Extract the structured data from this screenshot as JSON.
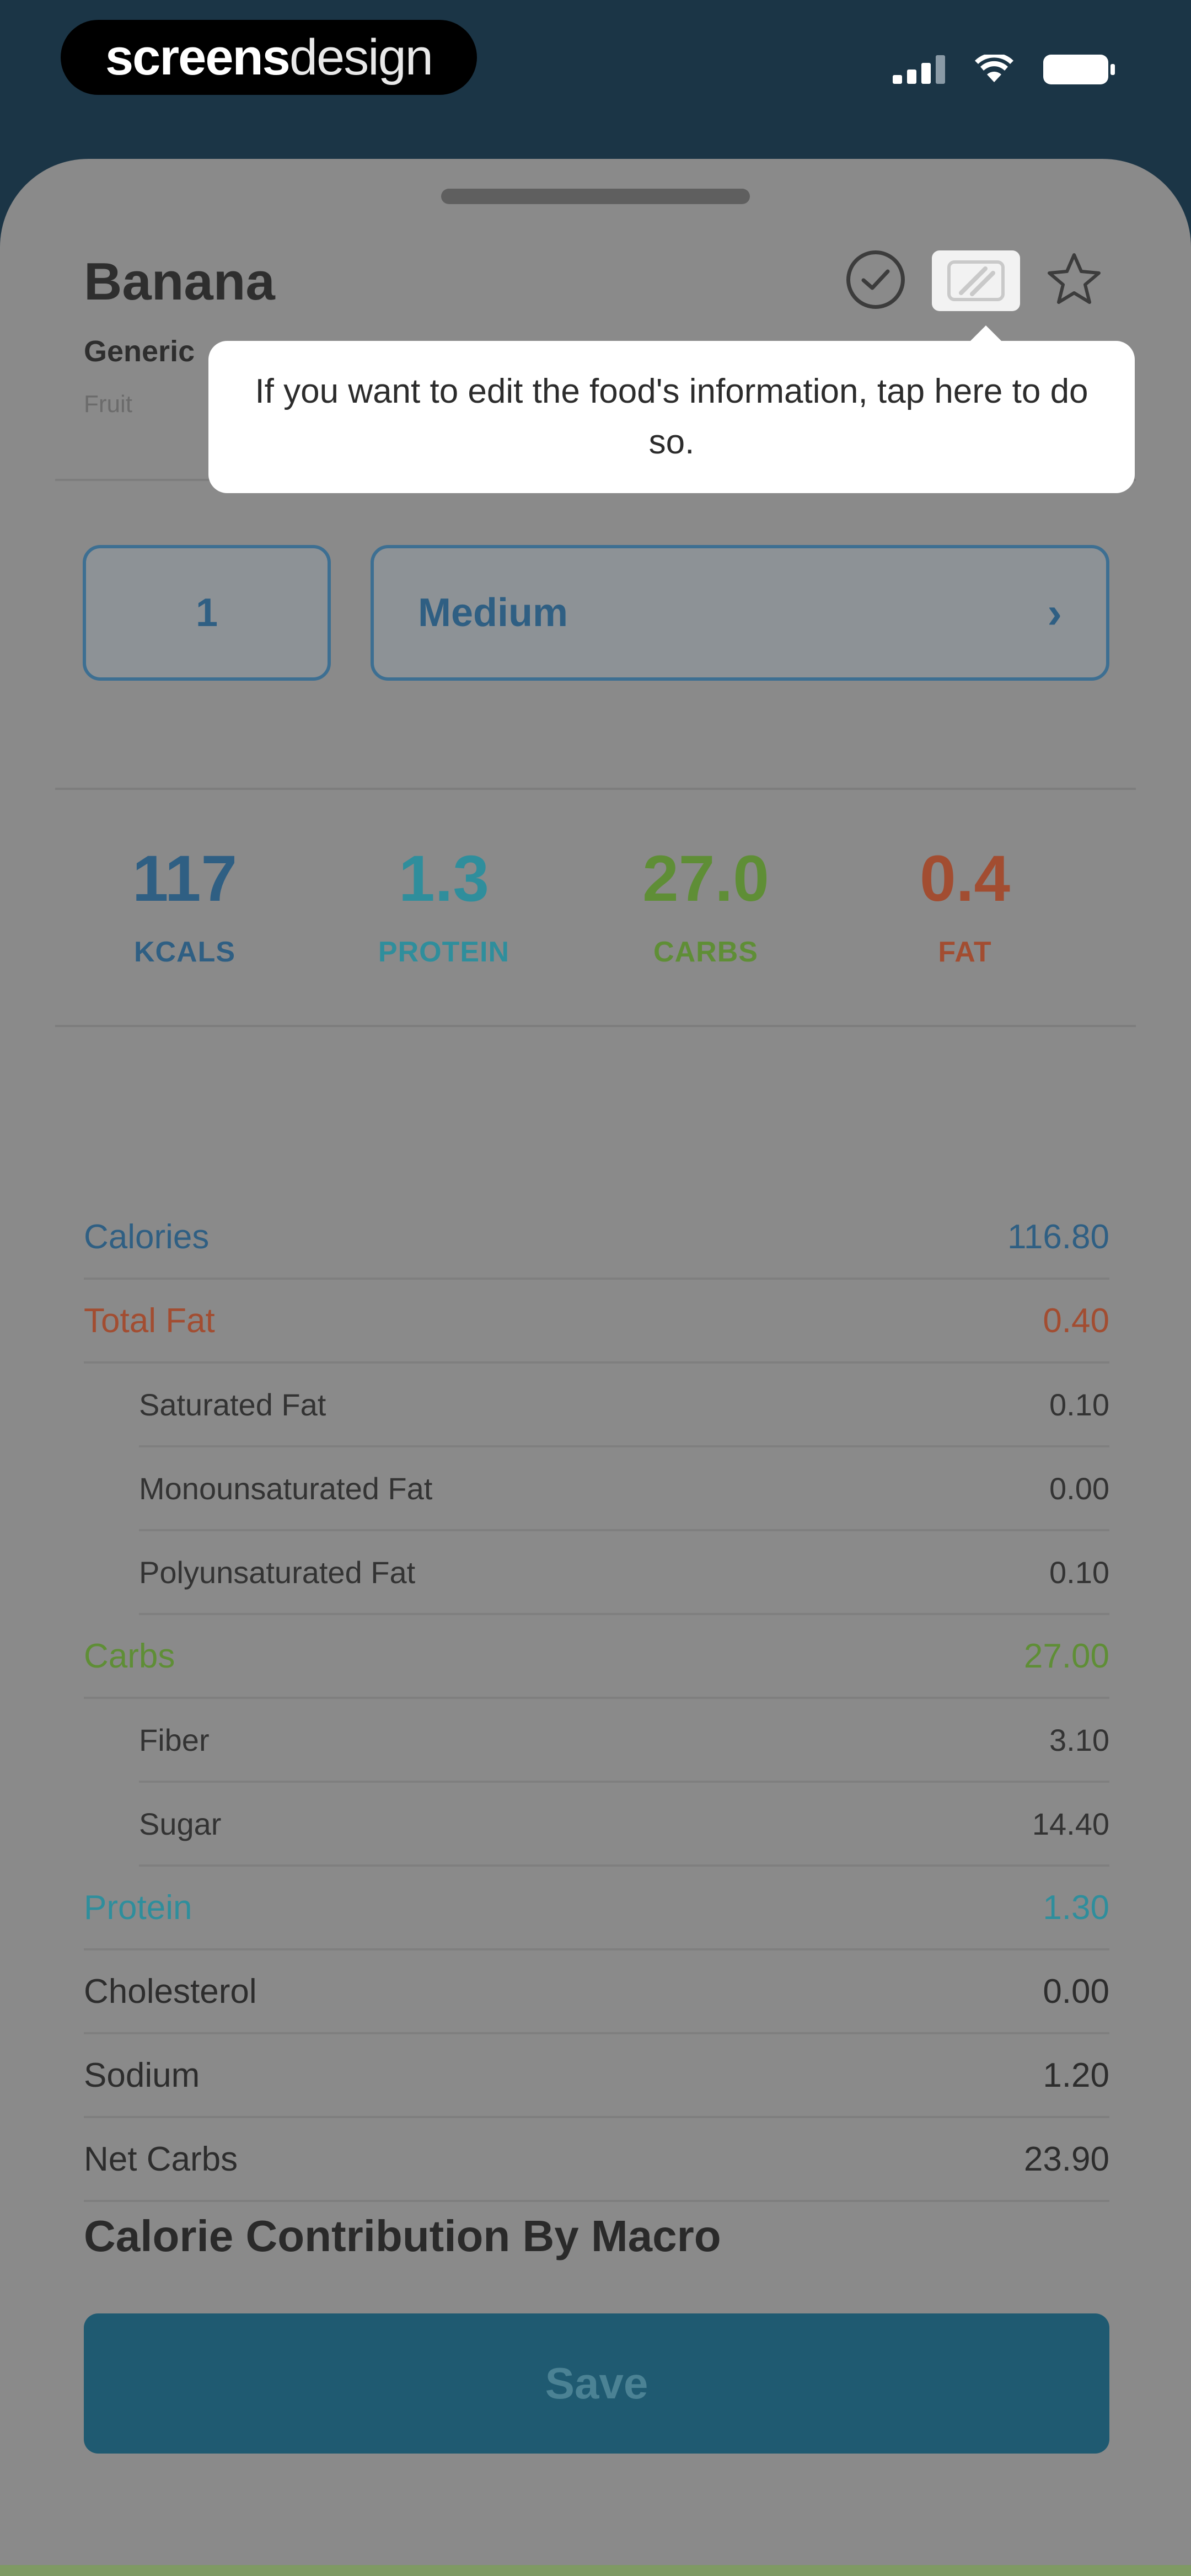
{
  "status_bar": {
    "brand_bold": "screens",
    "brand_light": "design"
  },
  "food": {
    "name": "Banana",
    "brand": "Generic",
    "category": "Fruit"
  },
  "tooltip": {
    "text": "If you want to edit the food's information, tap here to do so."
  },
  "serving": {
    "quantity": "1",
    "unit": "Medium"
  },
  "macros": [
    {
      "value": "117",
      "label": "KCALS",
      "color": "#2f5f83"
    },
    {
      "value": "1.3",
      "label": "PROTEIN",
      "color": "#2f8e9c"
    },
    {
      "value": "27.0",
      "label": "CARBS",
      "color": "#5f8e36"
    },
    {
      "value": "0.4",
      "label": "FAT",
      "color": "#a24d31"
    }
  ],
  "nutrition": [
    {
      "label": "Calories",
      "value": "116.80",
      "color": "#2f5f83",
      "sub": false
    },
    {
      "label": "Total Fat",
      "value": "0.40",
      "color": "#a24d31",
      "sub": false
    },
    {
      "label": "Saturated Fat",
      "value": "0.10",
      "color": "#333333",
      "sub": true
    },
    {
      "label": "Monounsaturated Fat",
      "value": "0.00",
      "color": "#333333",
      "sub": true
    },
    {
      "label": "Polyunsaturated Fat",
      "value": "0.10",
      "color": "#333333",
      "sub": true
    },
    {
      "label": "Carbs",
      "value": "27.00",
      "color": "#5f8e36",
      "sub": false
    },
    {
      "label": "Fiber",
      "value": "3.10",
      "color": "#333333",
      "sub": true
    },
    {
      "label": "Sugar",
      "value": "14.40",
      "color": "#333333",
      "sub": true
    },
    {
      "label": "Protein",
      "value": "1.30",
      "color": "#2f8e9c",
      "sub": false
    },
    {
      "label": "Cholesterol",
      "value": "0.00",
      "color": "#2d2d2d",
      "sub": false
    },
    {
      "label": "Sodium",
      "value": "1.20",
      "color": "#2d2d2d",
      "sub": false
    },
    {
      "label": "Net Carbs",
      "value": "23.90",
      "color": "#2d2d2d",
      "sub": false
    }
  ],
  "section": {
    "title": "Calorie Contribution By Macro"
  },
  "actions": {
    "save_label": "Save"
  }
}
